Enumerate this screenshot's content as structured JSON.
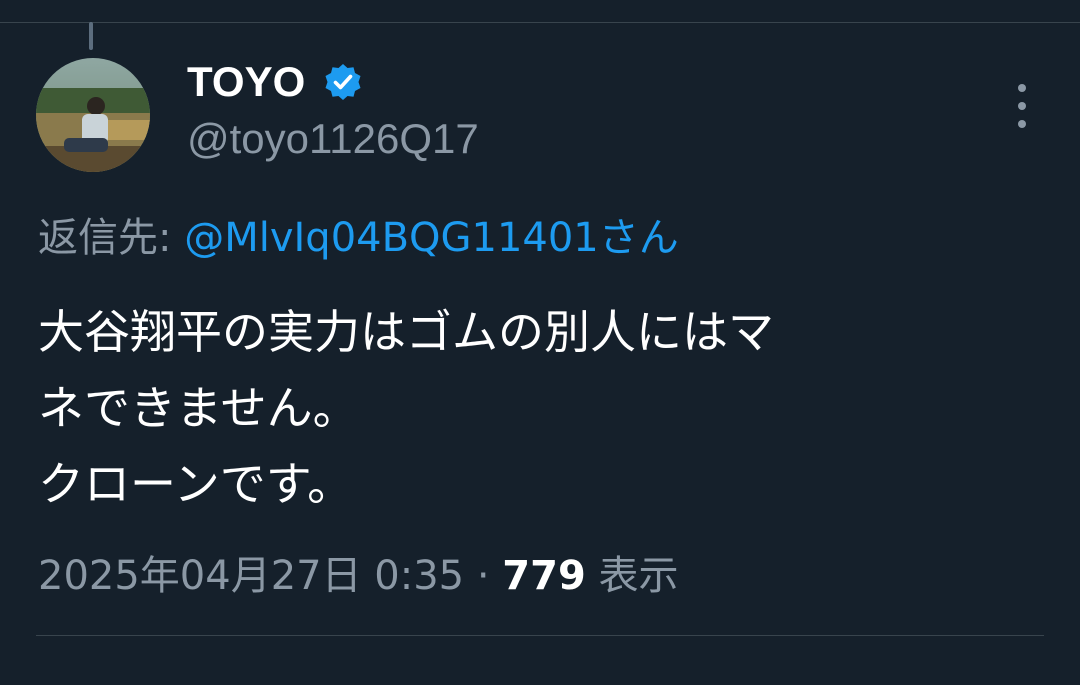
{
  "author": {
    "display_name": "TOYO",
    "handle": "@toyo1126Q17"
  },
  "reply": {
    "prefix": "返信先:",
    "handle": "@MlvIq04BQG11401さん"
  },
  "body": {
    "lines": [
      "大谷翔平の実力はゴムの別人にはマ",
      "ネできません。",
      "クローンです。"
    ]
  },
  "meta": {
    "datetime": "2025年04月27日 0:35",
    "separator": "·",
    "views_count": "779",
    "views_label": "表示"
  },
  "icons": {
    "verified": "verified-badge-icon",
    "more": "more-vertical-icon"
  },
  "colors": {
    "background": "#15202b",
    "accent": "#1d9bf0",
    "muted": "#8b98a5",
    "divider": "#38444d"
  }
}
